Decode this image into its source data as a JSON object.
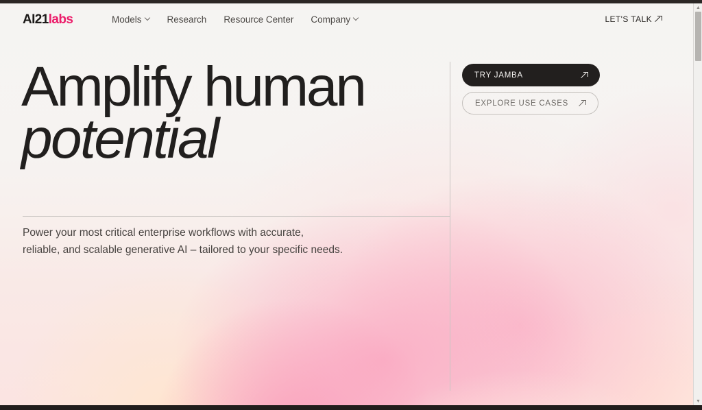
{
  "browser": {
    "scrollbar": {
      "up_arrow": "▲",
      "down_arrow": "▼"
    }
  },
  "header": {
    "logo": {
      "primary": "AI21",
      "accent": "labs",
      "primary_color": "#1c1a19",
      "accent_color": "#ec1e6b"
    },
    "nav": [
      {
        "label": "Models",
        "has_dropdown": true
      },
      {
        "label": "Research",
        "has_dropdown": false
      },
      {
        "label": "Resource Center",
        "has_dropdown": false
      },
      {
        "label": "Company",
        "has_dropdown": true
      }
    ],
    "cta": {
      "label": "LET'S TALK",
      "icon": "arrow-up-right-icon"
    }
  },
  "hero": {
    "headline_line1": "Amplify human",
    "headline_line2": "potential",
    "subhead_line1": "Power your most critical enterprise workflows with accurate,",
    "subhead_line2": "reliable, and scalable generative AI – tailored to your specific needs.",
    "buttons": [
      {
        "label": "TRY JAMBA",
        "style": "primary",
        "icon": "arrow-up-right-icon"
      },
      {
        "label": "EXPLORE USE CASES",
        "style": "secondary",
        "icon": "arrow-up-right-icon"
      }
    ]
  },
  "theme": {
    "page_background": "#f5f4f2",
    "text_primary": "#211f1e",
    "text_secondary": "#46423f",
    "brand_pink": "#ec1e6b",
    "gradient_pink": "#f9a6c0",
    "gradient_cream": "#ffe7cd",
    "gradient_peach": "#ffe2d8",
    "divider": "#c9c5c2",
    "button_dark": "#221f1e",
    "chrome_bar": "#2b2725"
  }
}
